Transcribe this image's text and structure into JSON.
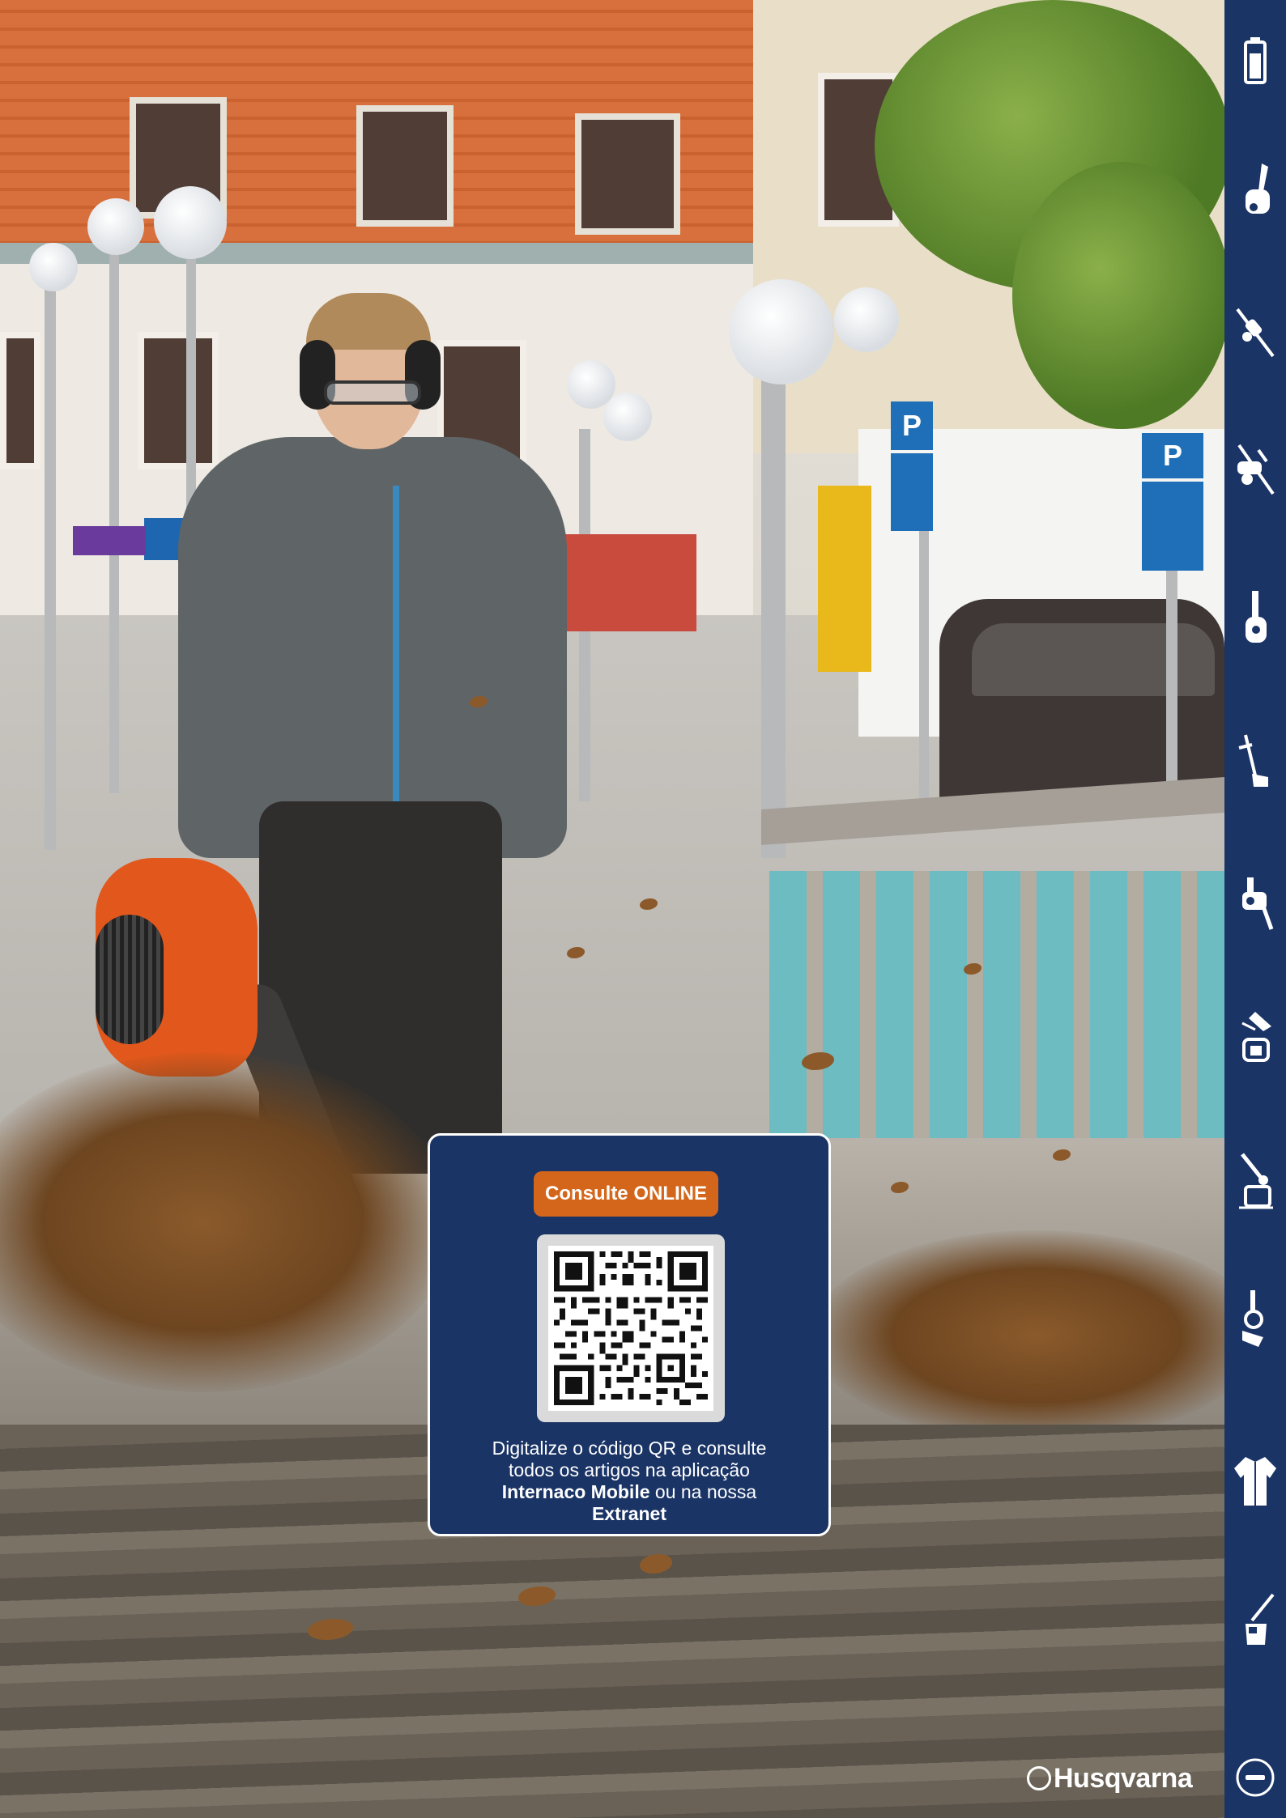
{
  "card": {
    "tag_label": "Consulte ONLINE",
    "text_line1": "Digitalize o código QR e consulte",
    "text_line2": "todos os artigos na aplicação",
    "text_bold1": "Internaco Mobile",
    "text_mid": " ou na nossa",
    "text_bold2": "Extranet"
  },
  "brand": {
    "name": "Husqvarna"
  },
  "sidebar": {
    "icons": [
      "battery-icon",
      "chainsaw-icon",
      "pole-saw-icon",
      "brushcutter-icon",
      "hedge-trimmer-icon",
      "trimmer-icon",
      "blower-icon",
      "sprayer-icon",
      "edger-icon",
      "cleaning-icon",
      "protective-clothing-icon",
      "accessories-icon",
      "info-icon"
    ]
  },
  "colors": {
    "navy": "#1a3466",
    "orange": "#d4661b",
    "white": "#ffffff"
  }
}
